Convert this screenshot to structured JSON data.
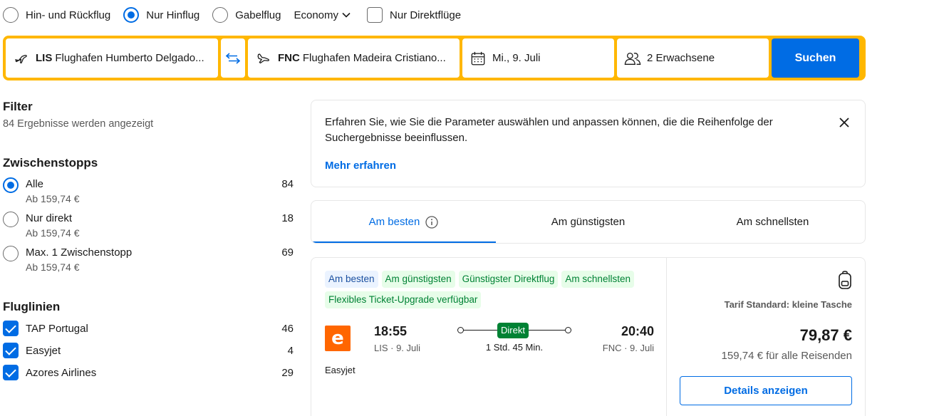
{
  "trip_type": {
    "options": [
      {
        "label": "Hin- und Rückflug",
        "selected": false
      },
      {
        "label": "Nur Hinflug",
        "selected": true
      },
      {
        "label": "Gabelflug",
        "selected": false
      }
    ],
    "cabin_class": "Economy",
    "direct_only_label": "Nur Direktflüge",
    "direct_only_checked": false
  },
  "search": {
    "from_code": "LIS",
    "from_name": "Flughafen Humberto Delgado...",
    "to_code": "FNC",
    "to_name": "Flughafen Madeira Cristiano...",
    "date": "Mi., 9. Juli",
    "passengers": "2 Erwachsene",
    "submit_label": "Suchen",
    "accent_color": "#ffb700",
    "button_color": "#006ce4"
  },
  "filters": {
    "title": "Filter",
    "results_count": "84 Ergebnisse werden angezeigt",
    "stops": {
      "title": "Zwischenstopps",
      "items": [
        {
          "label": "Alle",
          "count": "84",
          "price": "Ab 159,74 €",
          "selected": true
        },
        {
          "label": "Nur direkt",
          "count": "18",
          "price": "Ab 159,74 €",
          "selected": false
        },
        {
          "label": "Max. 1 Zwischenstopp",
          "count": "69",
          "price": "Ab 159,74 €",
          "selected": false
        }
      ]
    },
    "airlines": {
      "title": "Fluglinien",
      "items": [
        {
          "label": "TAP Portugal",
          "count": "46",
          "checked": true
        },
        {
          "label": "Easyjet",
          "count": "4",
          "checked": true
        },
        {
          "label": "Azores Airlines",
          "count": "29",
          "checked": true
        }
      ]
    }
  },
  "info_banner": {
    "text": "Erfahren Sie, wie Sie die Parameter auswählen und anpassen können, die die Reihenfolge der Suchergebnisse beeinflussen.",
    "link": "Mehr erfahren"
  },
  "sort_tabs": [
    {
      "label": "Am besten",
      "active": true,
      "has_info_icon": true
    },
    {
      "label": "Am günstigsten",
      "active": false
    },
    {
      "label": "Am schnellsten",
      "active": false
    }
  ],
  "result": {
    "badges": [
      {
        "label": "Am besten",
        "style": "blue"
      },
      {
        "label": "Am günstigsten",
        "style": "green"
      },
      {
        "label": "Günstigster Direktflug",
        "style": "green"
      },
      {
        "label": "Am schnellsten",
        "style": "green"
      },
      {
        "label": "Flexibles Ticket-Upgrade verfügbar",
        "style": "green"
      }
    ],
    "airline_logo_letter": "e",
    "airline_logo_color": "#ff6600",
    "airline": "Easyjet",
    "departure_time": "18:55",
    "departure_place": "LIS · 9. Juli",
    "arrival_time": "20:40",
    "arrival_place": "FNC · 9. Juli",
    "stops_label": "Direkt",
    "duration": "1 Std. 45 Min.",
    "tariff": "Tarif Standard: kleine Tasche",
    "price": "79,87 €",
    "price_total": "159,74 € für alle Reisenden",
    "details_label": "Details anzeigen"
  }
}
